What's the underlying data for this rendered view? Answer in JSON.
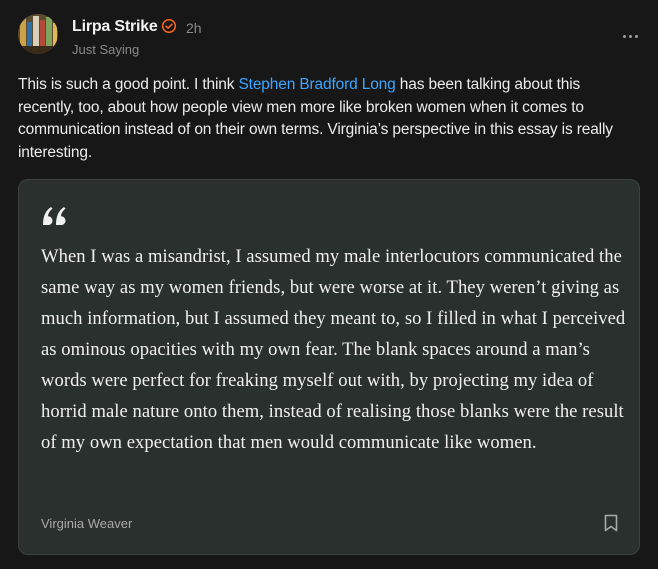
{
  "post": {
    "author": "Lirpa Strike",
    "time": "2h",
    "publication": "Just Saying",
    "body_before": "This is such a good point. I think ",
    "mention": "Stephen Bradford Long",
    "body_after": " has been talking about this recently, too, about how people view men more like broken women when it comes to communication instead of on their own terms. Virginia’s perspective in this essay is really interesting."
  },
  "quote": {
    "text": "When I was a misandrist, I assumed my male interlocutors communicated the same way as my women friends, but were worse at it. They weren’t giving as much information, but I assumed they meant to, so I filled in what I perceived as ominous opacities with my own fear. The blank spaces around a man’s words were perfect for freaking myself out with, by projecting my idea of horrid male nature onto them, instead of realising those blanks were the result of my own expectation that men would communicate like women.",
    "author": "Virginia Weaver"
  },
  "icons": {
    "verified": "verified-badge-icon",
    "more": "more-options-icon",
    "quote": "quotation-mark-icon",
    "bookmark": "bookmark-icon"
  },
  "colors": {
    "background": "#171717",
    "link": "#3ea6ff",
    "verified_badge": "#ff6719",
    "quote_card": "#2a302e"
  }
}
